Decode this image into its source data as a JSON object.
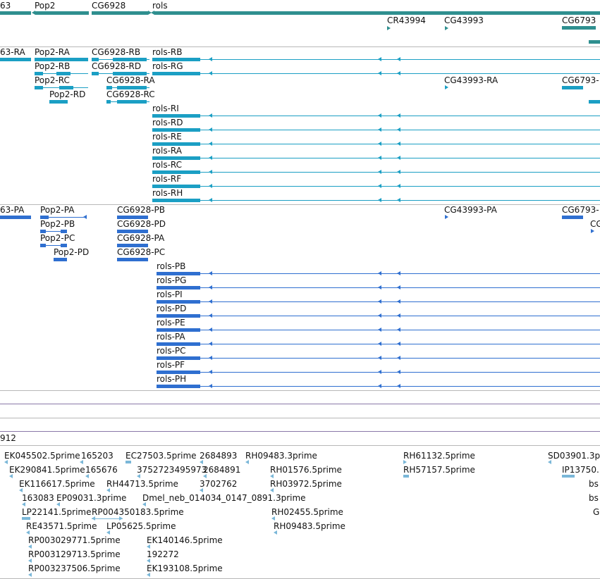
{
  "colors": {
    "gene": "#2f8f8f",
    "transcript": "#1b9fc4",
    "protein": "#2f6fd0",
    "est": "#7ab7d8",
    "separator": "#b8b8b8",
    "empty_track_line": "#8a78a8"
  },
  "icons": {
    "forward": "triangle-right",
    "reverse": "triangle-left"
  },
  "genes": [
    "63",
    "Pop2",
    "CG6928",
    "rols",
    "CR43994",
    "CG43993",
    "CG6793"
  ],
  "transcripts": {
    "left_cut": "63-RA",
    "pop2": [
      "Pop2-RA",
      "Pop2-RB",
      "Pop2-RC",
      "Pop2-RD"
    ],
    "cg6928": [
      "CG6928-RB",
      "CG6928-RD",
      "CG6928-RA",
      "CG6928-RC"
    ],
    "rols": [
      "rols-RB",
      "rols-RG",
      "rols-RI",
      "rols-RD",
      "rols-RE",
      "rols-RA",
      "rols-RC",
      "rols-RF",
      "rols-RH"
    ],
    "cg43993": "CG43993-RA",
    "cg6793": "CG6793-"
  },
  "proteins": {
    "left_cut": "63-PA",
    "pop2": [
      "Pop2-PA",
      "Pop2-PB",
      "Pop2-PC",
      "Pop2-PD"
    ],
    "cg6928": [
      "CG6928-PB",
      "CG6928-PD",
      "CG6928-PA",
      "CG6928-PC"
    ],
    "rols": [
      "rols-PB",
      "rols-PG",
      "rols-PI",
      "rols-PD",
      "rols-PE",
      "rols-PA",
      "rols-PC",
      "rols-PF",
      "rols-PH"
    ],
    "cg43993": "CG43993-PA",
    "cg6793": "CG6793-",
    "right_cut": "CG"
  },
  "cut_track_label": "912",
  "ests": [
    "EK045502.5prime",
    "165203",
    "EC27503.5prime",
    "2684893",
    "RH09483.3prime",
    "RH61132.5prime",
    "SD03901.3p",
    "EK290841.5prime",
    "165676",
    "3752723495973",
    "2684891",
    "RH01576.5prime",
    "RH57157.5prime",
    "IP13750.",
    "EK116617.5prime",
    "RH44713.5prime",
    "3702762",
    "RH03972.5prime",
    "bs",
    "163083",
    "EP09031.3prime",
    "Dmel_neb_014034_0147_0891.3prime",
    "bs",
    "LP22141.5prime",
    "RP004350183.5prime",
    "RH02455.5prime",
    "G",
    "RE43571.5prime",
    "LP05625.5prime",
    "RH09483.5prime",
    "RP003029771.5prime",
    "EK140146.5prime",
    "RP003129713.5prime",
    "192272",
    "RP003237506.5prime",
    "EK193108.5prime"
  ]
}
